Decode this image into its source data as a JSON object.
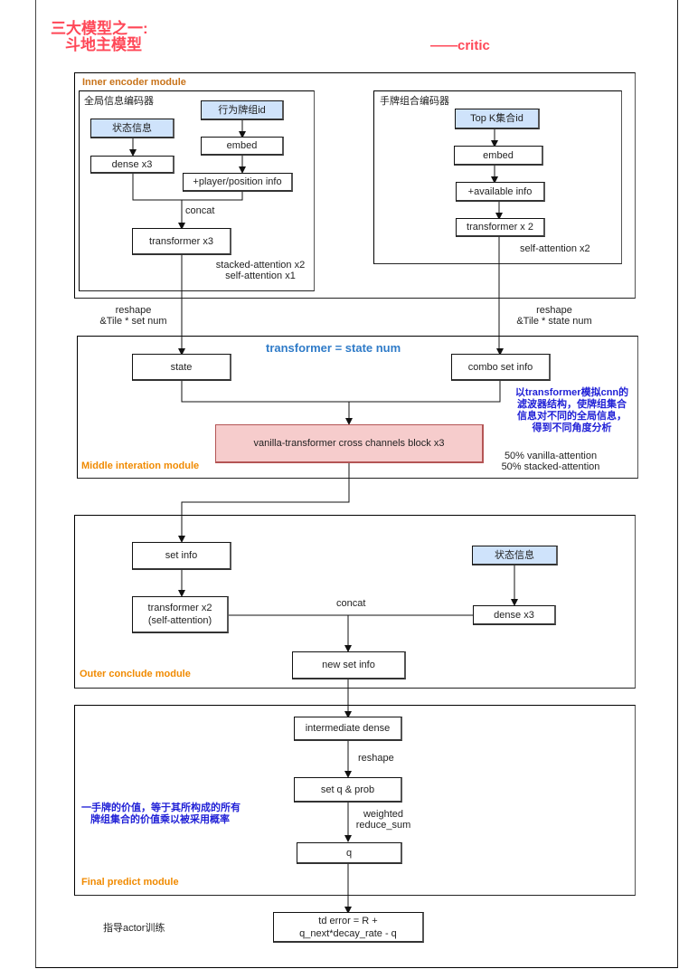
{
  "title": {
    "line1": "三大模型之一:",
    "line2": "斗地主模型",
    "subtitle": "——critic"
  },
  "colors": {
    "title_red": "#ff4757",
    "module_orange": "#f08a00",
    "inner_module_brown": "#c8731a",
    "note_blue": "#1f1fd6",
    "heading_blue": "#2f7bc8",
    "input_box_fill": "#cfe3fb",
    "cross_block_fill": "#f6cccc"
  },
  "inner_encoder": {
    "title": "Inner encoder module",
    "global_encoder": {
      "title": "全局信息编码器",
      "state_input": "状态信息",
      "dense": "dense x3",
      "action_input": "行为牌组id",
      "embed": "embed",
      "player_info": "+player/position info",
      "concat_label": "concat",
      "transformer": "transformer x3",
      "attention_note_1": "stacked-attention x2",
      "attention_note_2": "self-attention x1"
    },
    "hand_encoder": {
      "title": "手牌组合编码器",
      "topk_input": "Top K集合id",
      "embed": "embed",
      "available_info": "+available info",
      "transformer": "transformer x 2",
      "attention_note": "self-attention x2"
    },
    "reshape_left_1": "reshape",
    "reshape_left_2": "&Tile * set num",
    "reshape_right_1": "reshape",
    "reshape_right_2": "&Tile * state num"
  },
  "middle": {
    "heading": "transformer =  state num",
    "state": "state",
    "combo_set_info": "combo set info",
    "note_lines": [
      "以transformer模拟cnn的",
      "滤波器结构，使牌组集合",
      "信息对不同的全局信息，",
      "得到不同角度分析"
    ],
    "cross_block": "vanilla-transformer cross channels block x3",
    "ratio_1": "50% vanilla-attention",
    "ratio_2": "50% stacked-attention",
    "title": "Middle interation module"
  },
  "outer": {
    "set_info": "set info",
    "transformer_line1": "transformer x2",
    "transformer_line2": "(self-attention)",
    "state_input": "状态信息",
    "dense": "dense x3",
    "concat_label": "concat",
    "new_set_info": "new set info",
    "title": "Outer conclude module"
  },
  "final": {
    "intermediate_dense": "intermediate dense",
    "reshape_label": "reshape",
    "set_q_prob": "set q & prob",
    "weighted_1": "weighted",
    "weighted_2": "reduce_sum",
    "q": "q",
    "note_line1": "一手牌的价值，等于其所构成的所有",
    "note_line2": "牌组集合的价值乘以被采用概率",
    "title": "Final predict module"
  },
  "td_error": {
    "line1": "td error = R +",
    "line2": "q_next*decay_rate - q",
    "guide_label": "指导actor训练"
  }
}
